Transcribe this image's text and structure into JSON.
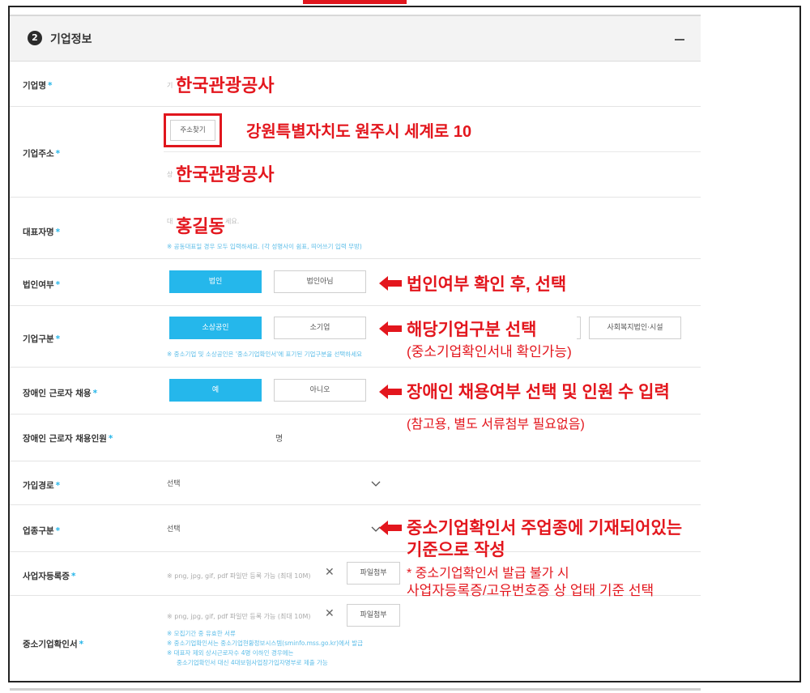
{
  "section": {
    "number": "2",
    "title": "기업정보"
  },
  "fields": {
    "company_name": {
      "label": "기업명",
      "req": "*",
      "placeholder": "기",
      "overlay": "한국관광공사"
    },
    "company_address": {
      "label": "기업주소",
      "req": "*",
      "button": "주소찾기",
      "address_overlay": "강원특별자치도 원주시 세계로 10",
      "detail_placeholder": "상",
      "detail_overlay": "한국관광공사"
    },
    "representative": {
      "label": "대표자명",
      "req": "*",
      "placeholder_a": "대",
      "placeholder_b": "세요.",
      "overlay": "홍길동",
      "hint": "※ 공동대표일 경우 모두 입력하세요. (각 성명사이 쉼표, 띄어쓰기 입력 무방)"
    },
    "corporation": {
      "label": "법인여부",
      "req": "*",
      "opt_yes": "법인",
      "opt_no": "법인아님"
    },
    "company_type": {
      "label": "기업구분",
      "req": "*",
      "opt_1": "소상공인",
      "opt_2": "소기업",
      "opt_4": "사회복지법인·시설",
      "hint": "※ 중소기업 및 소상공인은 '중소기업확인서'에 표기된 기업구분을 선택하세요"
    },
    "disabled_employment": {
      "label": "장애인 근로자 채용",
      "req": "*",
      "opt_yes": "예",
      "opt_no": "아니오"
    },
    "disabled_count": {
      "label": "장애인 근로자 채용인원",
      "req": "*",
      "unit": "명"
    },
    "join_route": {
      "label": "가입경로",
      "req": "*",
      "value": "선택"
    },
    "industry": {
      "label": "업종구분",
      "req": "*",
      "value": "선택"
    },
    "business_reg": {
      "label": "사업자등록증",
      "req": "*",
      "file_placeholder": "※ png, jpg, gif, pdf 파일만 등록 가능 (최대 10M)",
      "attach_button": "파일첨부"
    },
    "sme_cert": {
      "label": "중소기업확인서",
      "req": "*",
      "file_placeholder": "※ png, jpg, gif, pdf 파일만 등록 가능 (최대 10M)",
      "attach_button": "파일첨부",
      "notes": [
        "※ 모집기간 중 유효한 서류",
        "※ 중소기업확인서는 중소기업현황정보시스템(sminfo.mss.go.kr)에서 발급",
        "※ 대표자 제외 상시근로자수 4명 이하인 경우에는",
        "중소기업확인서 대신 4대보험사업장가입자명부로 제출 가능"
      ]
    }
  },
  "annotations": {
    "corporation": "법인여부 확인 후, 선택",
    "company_type": "해당기업구분 선택",
    "company_type_sub": "(중소기업확인서내 확인가능)",
    "disabled": "장애인 채용여부 선택 및 인원 수 입력",
    "disabled_sub": "(참고용, 별도 서류첨부 필요없음)",
    "industry_1": "중소기업확인서 주업종에 기재되어있는",
    "industry_2": "기준으로 작성",
    "industry_note_1": "* 중소기업확인서 발급 불가 시",
    "industry_note_2": "사업자등록증/고유번호증 상 업태 기준 선택"
  },
  "colors": {
    "accent": "#25b7eb",
    "annotation": "#e3161d",
    "required": "#25b5e9"
  }
}
